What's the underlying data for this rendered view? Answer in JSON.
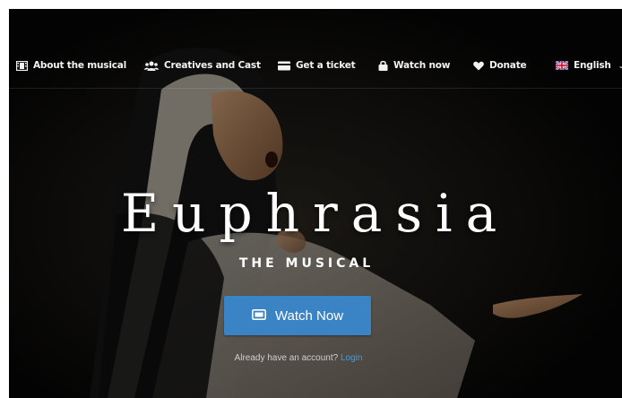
{
  "nav": {
    "items": [
      {
        "label": "About the musical",
        "icon": "film-icon"
      },
      {
        "label": "Creatives and Cast",
        "icon": "users-icon"
      },
      {
        "label": "Get a ticket",
        "icon": "ticket-icon"
      },
      {
        "label": "Watch now",
        "icon": "lock-icon"
      },
      {
        "label": "Donate",
        "icon": "heart-icon"
      },
      {
        "label": "English",
        "icon": "uk-flag-icon"
      }
    ]
  },
  "hero": {
    "title": "Euphrasia",
    "subtitle": "THE MUSICAL",
    "watch_button": "Watch Now",
    "account_prompt": "Already have an account?",
    "login_link": "Login"
  },
  "colors": {
    "background": "#050505",
    "accent_button": "#3a84c6",
    "link": "#3f9be8"
  }
}
